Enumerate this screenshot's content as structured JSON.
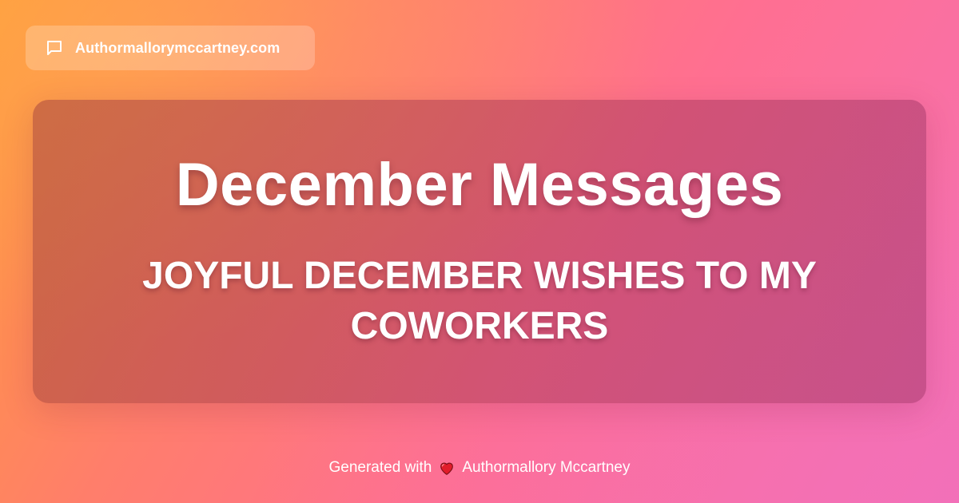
{
  "header": {
    "site_name": "Authormallorymccartney.com",
    "icon": "chat-bubble-icon"
  },
  "card": {
    "title": "December Messages",
    "subtitle": "JOYFUL DECEMBER WISHES TO MY COWORKERS"
  },
  "footer": {
    "prefix": "Generated with",
    "heart_icon": "heart-icon",
    "author": "Authormallory Mccartney"
  },
  "colors": {
    "gradient_start": "#ff9a3c",
    "gradient_mid": "#ff6f91",
    "gradient_end": "#f472b6",
    "heart": "#e11d2a",
    "text": "#ffffff"
  }
}
